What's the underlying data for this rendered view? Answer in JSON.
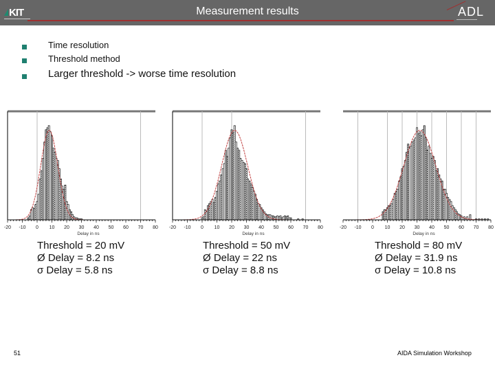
{
  "header": {
    "title": "Measurement results",
    "left_logo": "KIT",
    "right_logo": "ADL",
    "accent_color": "#a03030",
    "bar_color": "#666666"
  },
  "bullets": [
    {
      "label": "Time resolution"
    },
    {
      "label": "Threshold method"
    },
    {
      "label": "Larger threshold -> worse time resolution"
    }
  ],
  "footer": {
    "page_number": "51",
    "event": "AIDA Simulation Workshop"
  },
  "captions": [
    {
      "threshold": "Threshold = 20 mV",
      "mean": "Ø Delay = 8.2 ns",
      "sigma": "σ Delay = 5.8 ns"
    },
    {
      "threshold": "Threshold = 50 mV",
      "mean": "Ø Delay = 22 ns",
      "sigma": "σ Delay = 8.8 ns"
    },
    {
      "threshold": "Threshold = 80 mV",
      "mean": "Ø Delay = 31.9 ns",
      "sigma": "σ Delay = 10.8 ns"
    }
  ],
  "chart_data": [
    {
      "type": "bar",
      "title": "Threshold = 20 mV",
      "xlabel": "Delay in ns",
      "ylabel": "",
      "xlim": [
        -20,
        80
      ],
      "xticks": [
        -20,
        -10,
        0,
        10,
        20,
        30,
        40,
        50,
        60,
        70,
        80
      ],
      "grid": "vertical at 0 and 70",
      "fit": {
        "type": "gaussian",
        "mean": 8.2,
        "sigma": 5.8,
        "color": "#c04040"
      },
      "bin_width": 1,
      "x": [
        -6,
        -5,
        -4,
        -3,
        -2,
        -1,
        0,
        1,
        2,
        3,
        4,
        5,
        6,
        7,
        8,
        9,
        10,
        11,
        12,
        13,
        14,
        15,
        16,
        17,
        18,
        19,
        20,
        21,
        22,
        23,
        24,
        25,
        26,
        27,
        28,
        29,
        30
      ],
      "values": [
        2,
        4,
        10,
        12,
        11,
        15,
        18,
        25,
        40,
        48,
        60,
        76,
        88,
        90,
        92,
        86,
        82,
        70,
        66,
        60,
        58,
        50,
        40,
        33,
        30,
        34,
        18,
        15,
        10,
        8,
        5,
        3,
        2,
        2,
        1,
        1,
        1
      ]
    },
    {
      "type": "bar",
      "title": "Threshold = 50 mV",
      "xlabel": "Delay in ns",
      "ylabel": "",
      "xlim": [
        -20,
        80
      ],
      "xticks": [
        -20,
        -10,
        0,
        10,
        20,
        30,
        40,
        50,
        60,
        70,
        80
      ],
      "grid": "vertical at 0, 20 and 70",
      "fit": {
        "type": "gaussian",
        "mean": 22,
        "sigma": 8.8,
        "color": "#c04040"
      },
      "bin_width": 1,
      "x": [
        0,
        1,
        2,
        3,
        4,
        5,
        6,
        7,
        8,
        9,
        10,
        11,
        12,
        13,
        14,
        15,
        16,
        17,
        18,
        19,
        20,
        21,
        22,
        23,
        24,
        25,
        26,
        27,
        28,
        29,
        30,
        31,
        32,
        33,
        34,
        35,
        36,
        37,
        38,
        39,
        40,
        41,
        42,
        43,
        44,
        45,
        46,
        47,
        48,
        49,
        50,
        51,
        52,
        53,
        54,
        55,
        56,
        57,
        58,
        59,
        60,
        65,
        68
      ],
      "values": [
        2,
        3,
        10,
        8,
        14,
        16,
        18,
        20,
        17,
        22,
        28,
        35,
        38,
        44,
        50,
        55,
        68,
        62,
        70,
        80,
        88,
        85,
        92,
        76,
        70,
        68,
        60,
        58,
        56,
        55,
        50,
        40,
        38,
        35,
        32,
        28,
        25,
        20,
        16,
        15,
        12,
        10,
        8,
        6,
        5,
        5,
        5,
        4,
        4,
        3,
        3,
        4,
        3,
        4,
        2,
        3,
        4,
        3,
        4,
        2,
        2,
        1,
        1
      ]
    },
    {
      "type": "bar",
      "title": "Threshold = 80 mV",
      "xlabel": "Delay in ns",
      "ylabel": "",
      "xlim": [
        -20,
        80
      ],
      "xticks": [
        -20,
        -10,
        0,
        10,
        20,
        30,
        40,
        50,
        60,
        70,
        80
      ],
      "grid": "vertical at -10, 10, 20, 30, 40, 50, 60, 70",
      "fit": {
        "type": "gaussian",
        "mean": 31.9,
        "sigma": 10.8,
        "color": "#c04040"
      },
      "bin_width": 1,
      "x": [
        7,
        8,
        9,
        10,
        11,
        12,
        13,
        14,
        15,
        16,
        17,
        18,
        19,
        20,
        21,
        22,
        23,
        24,
        25,
        26,
        27,
        28,
        29,
        30,
        31,
        32,
        33,
        34,
        35,
        36,
        37,
        38,
        39,
        40,
        41,
        42,
        43,
        44,
        45,
        46,
        47,
        48,
        49,
        50,
        51,
        52,
        53,
        54,
        55,
        56,
        57,
        58,
        59,
        60,
        62,
        64,
        66,
        70,
        72,
        74,
        76,
        78
      ],
      "values": [
        8,
        10,
        10,
        12,
        14,
        14,
        16,
        20,
        26,
        28,
        30,
        38,
        42,
        50,
        52,
        58,
        66,
        74,
        70,
        72,
        76,
        78,
        80,
        90,
        84,
        86,
        82,
        88,
        92,
        80,
        68,
        72,
        65,
        60,
        62,
        58,
        48,
        50,
        44,
        40,
        38,
        30,
        30,
        26,
        22,
        20,
        18,
        14,
        12,
        10,
        8,
        6,
        5,
        4,
        3,
        3,
        5,
        1,
        1,
        1,
        1,
        1
      ]
    }
  ]
}
